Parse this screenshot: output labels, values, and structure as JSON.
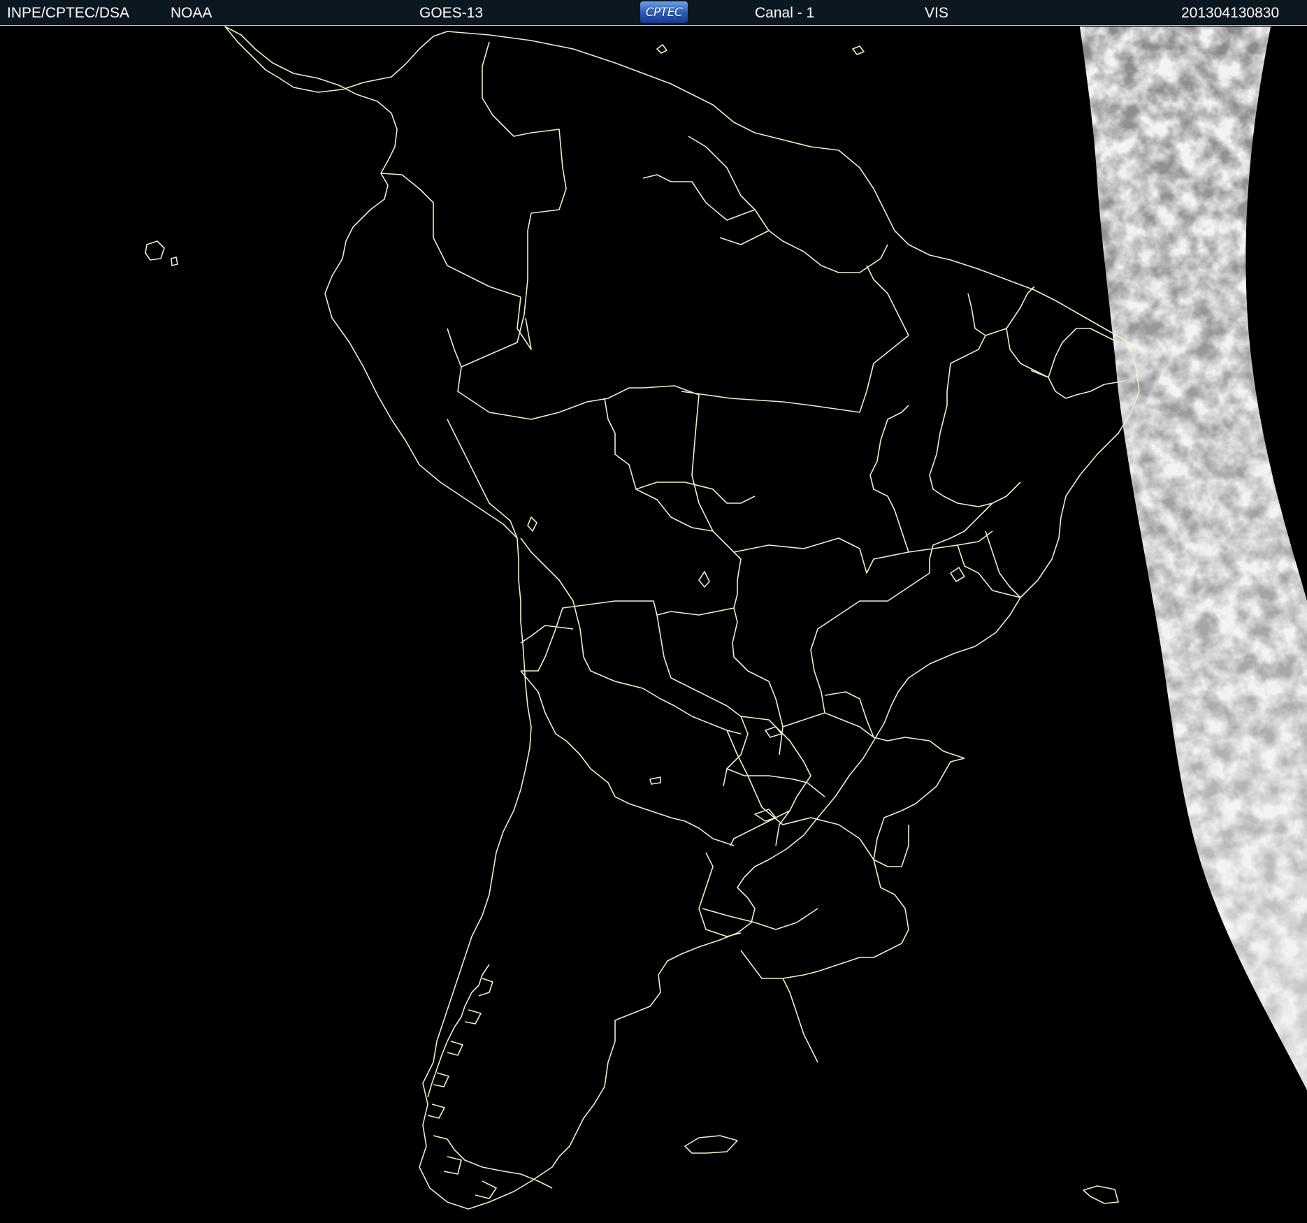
{
  "header": {
    "organization": "INPE/CPTEC/DSA",
    "agency": "NOAA",
    "satellite": "GOES-13",
    "channel": "Canal - 1",
    "band": "VIS",
    "timestamp": "201304130830",
    "logo_text": "CPTEC"
  },
  "map": {
    "background_color": "#000000",
    "boundary_color": "#f0edc8",
    "cloud_color": "#9a9a9a"
  }
}
